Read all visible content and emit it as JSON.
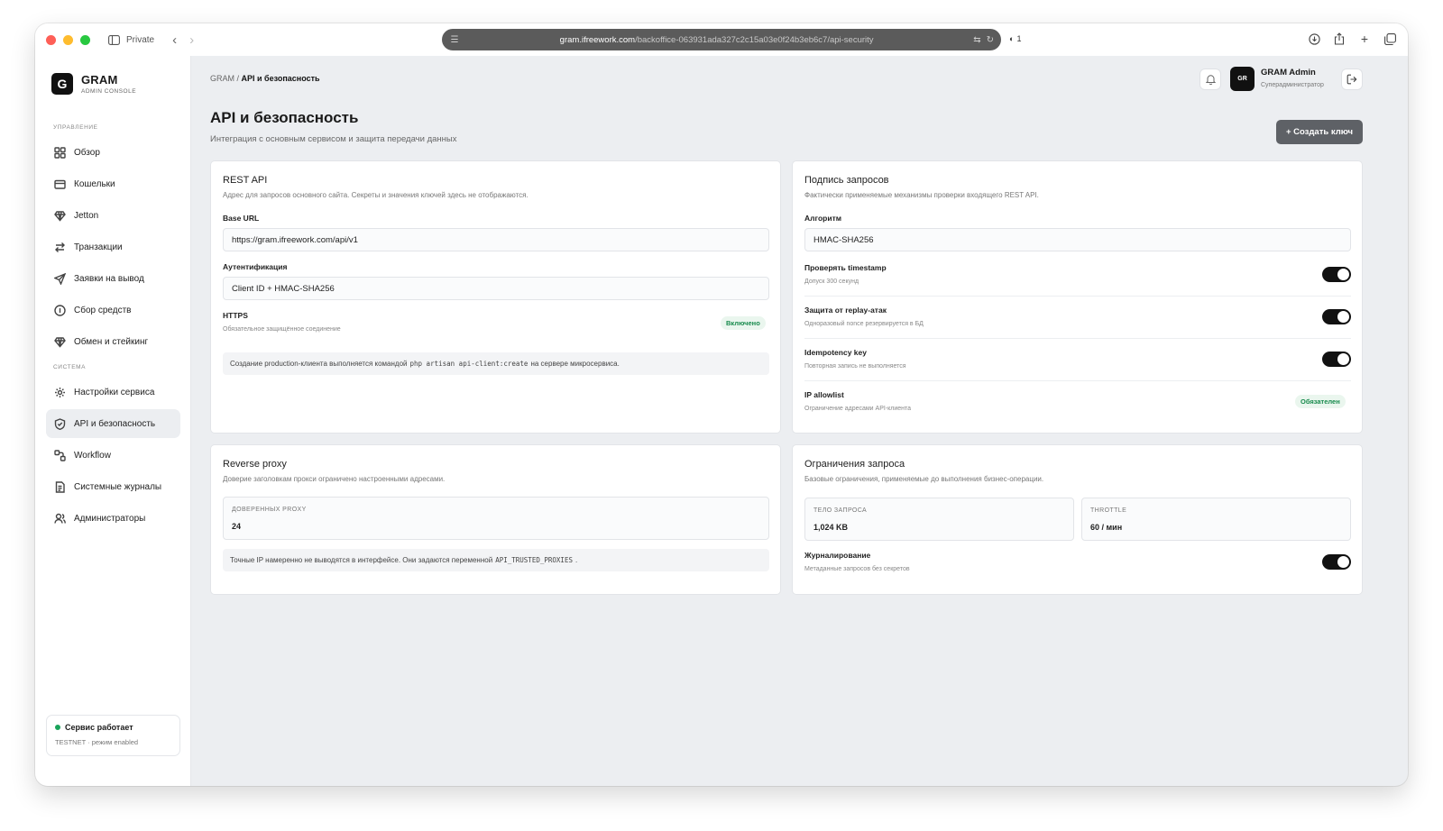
{
  "browser": {
    "private_label": "Private",
    "url_host": "gram.ifreework.com",
    "url_path": "/backoffice-063931ada327c2c15a03e0f24b3eb6c7/api-security",
    "shield_count": "1"
  },
  "sidebar": {
    "logo_letter": "G",
    "brand": "GRAM",
    "brand_sub": "ADMIN CONSOLE",
    "section_manage": "УПРАВЛЕНИЕ",
    "section_system": "СИСТЕМА",
    "items": [
      {
        "label": "Обзор",
        "icon": "grid-icon"
      },
      {
        "label": "Кошельки",
        "icon": "wallet-icon"
      },
      {
        "label": "Jetton",
        "icon": "diamond-icon"
      },
      {
        "label": "Транзакции",
        "icon": "transfer-icon"
      },
      {
        "label": "Заявки на вывод",
        "icon": "send-icon"
      },
      {
        "label": "Сбор средств",
        "icon": "coin-icon"
      },
      {
        "label": "Обмен и стейкинг",
        "icon": "diamond-icon"
      },
      {
        "label": "Настройки сервиса",
        "icon": "gear-icon"
      },
      {
        "label": "API и безопасность",
        "icon": "shield-icon"
      },
      {
        "label": "Workflow",
        "icon": "workflow-icon"
      },
      {
        "label": "Системные журналы",
        "icon": "log-icon"
      },
      {
        "label": "Администраторы",
        "icon": "users-icon"
      }
    ],
    "service_status": "Сервис работает",
    "service_sub": "TESTNET · режим enabled"
  },
  "header": {
    "breadcrumb_root": "GRAM",
    "breadcrumb_sep": " / ",
    "breadcrumb_current": "API и безопасность",
    "avatar_initials": "GR",
    "user_name": "GRAM Admin",
    "user_role": "Суперадминистратор"
  },
  "page": {
    "title": "API и безопасность",
    "subtitle": "Интеграция с основным сервисом и защита передачи данных",
    "create_button": "+ Создать ключ"
  },
  "rest_api": {
    "title": "REST API",
    "subtitle": "Адрес для запросов основного сайта. Секреты и значения ключей здесь не отображаются.",
    "base_url_label": "Base URL",
    "base_url_value": "https://gram.ifreework.com/api/v1",
    "auth_label": "Аутентификация",
    "auth_value": "Client ID + HMAC-SHA256",
    "https_title": "HTTPS",
    "https_sub": "Обязательное защищённое соединение",
    "https_badge": "Включено",
    "note_before": "Создание production-клиента выполняется командой",
    "note_code": "php artisan api-client:create",
    "note_after": "на сервере микросервиса."
  },
  "signing": {
    "title": "Подпись запросов",
    "subtitle": "Фактически применяемые механизмы проверки входящего REST API.",
    "algo_label": "Алгоритм",
    "algo_value": "HMAC-SHA256",
    "rows": [
      {
        "title": "Проверять timestamp",
        "sub": "Допуск 300 секунд",
        "enabled": true
      },
      {
        "title": "Защита от replay-атак",
        "sub": "Одноразовый nonce резервируется в БД",
        "enabled": true
      },
      {
        "title": "Idempotency key",
        "sub": "Повторная запись не выполняется",
        "enabled": true
      },
      {
        "title": "IP allowlist",
        "sub": "Ограничение адресами API-клиента",
        "badge": "Обязателен"
      }
    ]
  },
  "proxy": {
    "title": "Reverse proxy",
    "subtitle": "Доверие заголовкам прокси ограничено настроенными адресами.",
    "stat_label": "ДОВЕРЕННЫХ PROXY",
    "stat_value": "24",
    "note_before": "Точные IP намеренно не выводятся в интерфейсе. Они задаются переменной",
    "note_code": "API_TRUSTED_PROXIES",
    "note_after": "."
  },
  "limits": {
    "title": "Ограничения запроса",
    "subtitle": "Базовые ограничения, применяемые до выполнения бизнес-операции.",
    "body_label": "ТЕЛО ЗАПРОСА",
    "body_value": "1,024 KB",
    "throttle_label": "THROTTLE",
    "throttle_value": "60 / мин",
    "log_title": "Журналирование",
    "log_sub": "Метаданные запросов без секретов",
    "log_enabled": true
  }
}
